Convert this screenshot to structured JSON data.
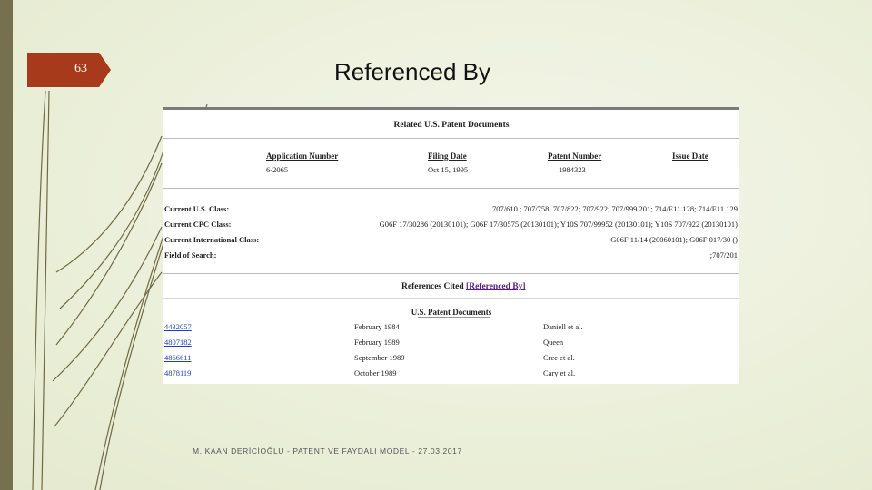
{
  "slide": {
    "number": "63",
    "title": "Referenced By",
    "footer": "M. KAAN DERİCİOĞLU - PATENT VE FAYDALI MODEL - 27.03.2017"
  },
  "patent_doc": {
    "related_header": "Related U.S. Patent Documents",
    "columns": [
      "Application Number",
      "Filing Date",
      "Patent Number",
      "Issue Date"
    ],
    "related_row": {
      "application_number": "6-2065",
      "filing_date": "Oct 15, 1995",
      "patent_number": "1984323",
      "issue_date": ""
    },
    "classes": [
      {
        "label": "Current U.S. Class:",
        "value": "707/610 ; 707/758; 707/822; 707/922; 707/999.201; 714/E11.128; 714/E11.129"
      },
      {
        "label": "Current CPC Class:",
        "value": "G06F 17/30286 (20130101); G06F 17/30575 (20130101); Y10S 707/99952 (20130101); Y10S 707/922 (20130101)"
      },
      {
        "label": "Current International Class:",
        "value": "G06F 11/14 (20060101); G06F 017/30 ()"
      },
      {
        "label": "Field of Search:",
        "value": ";707/201"
      }
    ],
    "references_cited_label": "References Cited",
    "referenced_by_link": "[Referenced By]",
    "us_patent_documents_header": "U.S. Patent Documents",
    "references": [
      {
        "patent": "4432057",
        "date": "February 1984",
        "name": "Daniell et al."
      },
      {
        "patent": "4807182",
        "date": "February 1989",
        "name": "Queen"
      },
      {
        "patent": "4866611",
        "date": "September 1989",
        "name": "Cree et al."
      },
      {
        "patent": "4878119",
        "date": "October 1989",
        "name": "Cary et al."
      }
    ]
  },
  "colors": {
    "accent": "#a83a1c",
    "left_bar": "#76704f",
    "link": "#1a3ecb",
    "visited_link": "#5a1a8a"
  }
}
